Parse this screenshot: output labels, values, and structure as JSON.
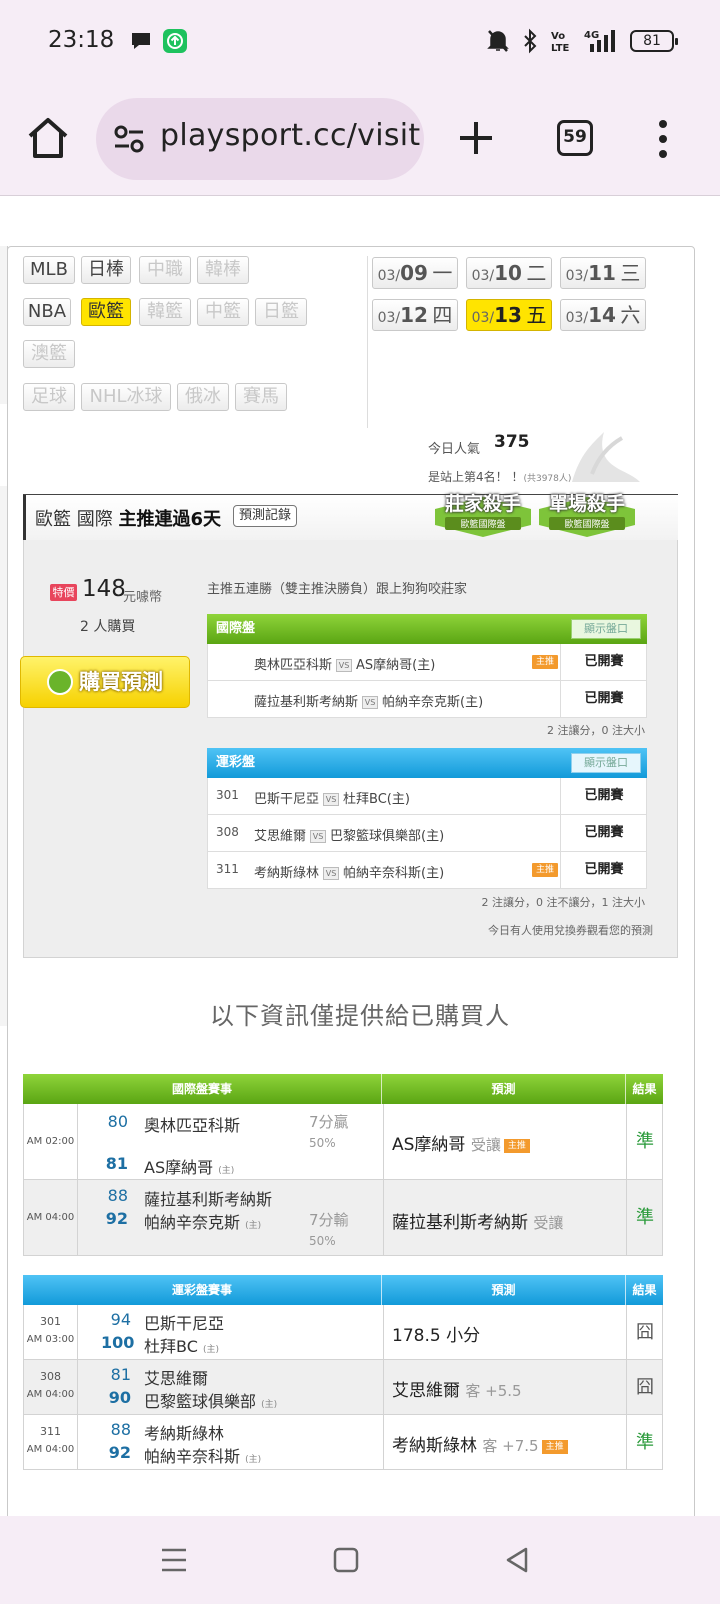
{
  "status": {
    "time": "23:18",
    "battery": "81",
    "network": "4G"
  },
  "browser": {
    "url": "playsport.cc/visit",
    "tab_count": "59"
  },
  "sports": [
    {
      "label": "MLB",
      "state": "normal"
    },
    {
      "label": "日棒",
      "state": "normal"
    },
    {
      "label": "中職",
      "state": "off"
    },
    {
      "label": "韓棒",
      "state": "off"
    },
    {
      "label": "NBA",
      "state": "normal"
    },
    {
      "label": "歐籃",
      "state": "selected"
    },
    {
      "label": "韓籃",
      "state": "off"
    },
    {
      "label": "中籃",
      "state": "off"
    },
    {
      "label": "日籃",
      "state": "off"
    },
    {
      "label": "澳籃",
      "state": "off"
    },
    {
      "label": "足球",
      "state": "off"
    },
    {
      "label": "NHL冰球",
      "state": "off"
    },
    {
      "label": "俄冰",
      "state": "off"
    },
    {
      "label": "賽馬",
      "state": "off"
    }
  ],
  "dates": [
    {
      "month": "03/",
      "day": "09",
      "weekday": "一",
      "selected": false
    },
    {
      "month": "03/",
      "day": "10",
      "weekday": "二",
      "selected": false
    },
    {
      "month": "03/",
      "day": "11",
      "weekday": "三",
      "selected": false
    },
    {
      "month": "03/",
      "day": "12",
      "weekday": "四",
      "selected": false
    },
    {
      "month": "03/",
      "day": "13",
      "weekday": "五",
      "selected": true
    },
    {
      "month": "03/",
      "day": "14",
      "weekday": "六",
      "selected": false
    }
  ],
  "popularity": {
    "label": "今日人氣",
    "value": "375",
    "rank": "是站上第4名！",
    "total": "(共3978人)"
  },
  "predictor": {
    "title_league": "歐籃 國際",
    "title_streak": "主推連過6天",
    "record_button": "預測記錄",
    "badges": [
      {
        "title": "莊家殺手",
        "sub": "歐籃國際盤"
      },
      {
        "title": "單場殺手",
        "sub": "歐籃國際盤"
      }
    ],
    "price_tag": "特價",
    "price": "148",
    "price_unit": "元噱幣",
    "buyers": "2 人購買",
    "buy_button": "購買預測",
    "description": "主推五連勝（雙主推決勝負）跟上狗狗咬莊家"
  },
  "intl_panel": {
    "title": "國際盤",
    "show_button": "顯示盤口",
    "rows": [
      {
        "num": "",
        "away": "奧林匹亞科斯",
        "home": "AS摩納哥(主)",
        "main": true,
        "status": "已開賽"
      },
      {
        "num": "",
        "away": "薩拉基利斯考納斯",
        "home": "帕納辛奈克斯(主)",
        "main": false,
        "status": "已開賽"
      }
    ],
    "summary": "2 注讓分，0 注大小"
  },
  "lottery_panel": {
    "title": "運彩盤",
    "show_button": "顯示盤口",
    "rows": [
      {
        "num": "301",
        "away": "巴斯干尼亞",
        "home": "杜拜BC(主)",
        "main": false,
        "status": "已開賽"
      },
      {
        "num": "308",
        "away": "艾思維爾",
        "home": "巴黎籃球俱樂部(主)",
        "main": false,
        "status": "已開賽"
      },
      {
        "num": "311",
        "away": "考納斯綠林",
        "home": "帕納辛奈科斯(主)",
        "main": true,
        "status": "已開賽"
      }
    ],
    "summary": "2 注讓分，0 注不讓分，1 注大小"
  },
  "today_note": "今日有人使用兌換券觀看您的預測",
  "info_only": "以下資訊僅提供給已購買人",
  "main_tag": "主推",
  "home_mark": "(主)",
  "intl_results": {
    "headers": [
      "國際盤賽事",
      "預測",
      "結果"
    ],
    "rows": [
      {
        "time": "AM 02:00",
        "s1": "80",
        "t1": "奧林匹亞科斯",
        "s2": "81",
        "t2": "AS摩納哥",
        "hcp": "7分贏",
        "pct": "50%",
        "pred": "AS摩納哥",
        "pred_extra": "受讓",
        "main": true,
        "result": "準"
      },
      {
        "time": "AM 04:00",
        "s1": "88",
        "t1": "薩拉基利斯考納斯",
        "s2": "92",
        "t2": "帕納辛奈克斯",
        "hcp": "7分輸",
        "pct": "50%",
        "pred": "薩拉基利斯考納斯",
        "pred_extra": "受讓",
        "main": false,
        "result": "準"
      }
    ]
  },
  "lottery_results": {
    "headers": [
      "運彩盤賽事",
      "預測",
      "結果"
    ],
    "rows": [
      {
        "num": "301",
        "time": "AM 03:00",
        "s1": "94",
        "t1": "巴斯干尼亞",
        "s2": "100",
        "t2": "杜拜BC",
        "pred": "178.5 小分",
        "pred_extra": "",
        "main": false,
        "result": "囧"
      },
      {
        "num": "308",
        "time": "AM 04:00",
        "s1": "81",
        "t1": "艾思維爾",
        "s2": "90",
        "t2": "巴黎籃球俱樂部",
        "pred": "艾思維爾",
        "pred_extra": "客 +5.5",
        "main": false,
        "result": "囧"
      },
      {
        "num": "311",
        "time": "AM 04:00",
        "s1": "88",
        "t1": "考納斯綠林",
        "s2": "92",
        "t2": "帕納辛奈科斯",
        "pred": "考納斯綠林",
        "pred_extra": "客 +7.5",
        "main": true,
        "result": "準"
      }
    ]
  },
  "colors": {
    "selected": "#ffe400",
    "green_header": "#5aa513",
    "blue_header": "#129ad9",
    "win": "#2a9a3a",
    "main_tag": "#f39a2d"
  }
}
